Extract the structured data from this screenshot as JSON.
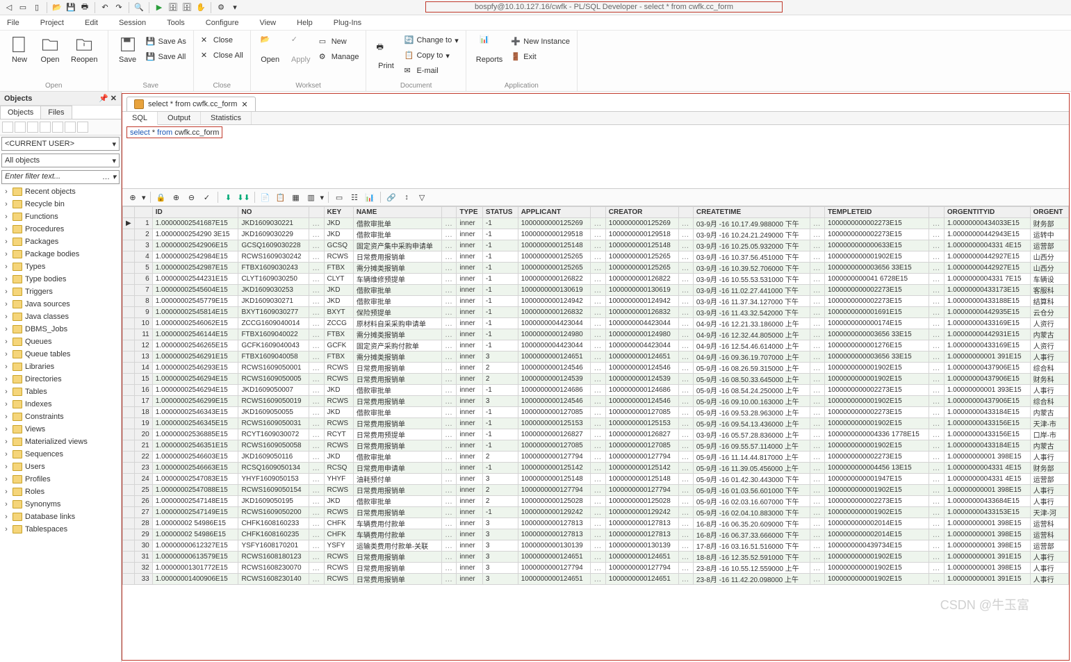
{
  "title": "bospfy@10.10.127.16/cwfk - PL/SQL Developer - select * from cwfk.cc_form",
  "menu": {
    "file": "File",
    "project": "Project",
    "edit": "Edit",
    "session": "Session",
    "tools": "Tools",
    "configure": "Configure",
    "view": "View",
    "help": "Help",
    "plugins": "Plug-Ins"
  },
  "ribbon": {
    "open": {
      "new": "New",
      "open": "Open",
      "reopen": "Reopen",
      "label": "Open"
    },
    "save": {
      "save": "Save",
      "saveas": "Save As",
      "saveall": "Save All",
      "label": "Save"
    },
    "close": {
      "close": "Close",
      "closeall": "Close All",
      "label": "Close"
    },
    "workset": {
      "open": "Open",
      "apply": "Apply",
      "new": "New",
      "manage": "Manage",
      "label": "Workset"
    },
    "doc": {
      "print": "Print",
      "changeto": "Change to",
      "copyto": "Copy to",
      "email": "E-mail",
      "label": "Document"
    },
    "app": {
      "reports": "Reports",
      "newinst": "New Instance",
      "exit": "Exit",
      "label": "Application"
    }
  },
  "sidebar": {
    "title": "Objects",
    "tabs": {
      "objects": "Objects",
      "files": "Files"
    },
    "user": "<CURRENT USER>",
    "scope": "All objects",
    "filter_ph": "Enter filter text...",
    "nodes": [
      "Recent objects",
      "Recycle bin",
      "Functions",
      "Procedures",
      "Packages",
      "Package bodies",
      "Types",
      "Type bodies",
      "Triggers",
      "Java sources",
      "Java classes",
      "DBMS_Jobs",
      "Queues",
      "Queue tables",
      "Libraries",
      "Directories",
      "Tables",
      "Indexes",
      "Constraints",
      "Views",
      "Materialized views",
      "Sequences",
      "Users",
      "Profiles",
      "Roles",
      "Synonyms",
      "Database links",
      "Tablespaces"
    ]
  },
  "doc": {
    "tab": "select * from cwfk.cc_form",
    "subtabs": {
      "sql": "SQL",
      "output": "Output",
      "stats": "Statistics"
    },
    "sql": {
      "kw1": "select",
      "rest": " * ",
      "kw2": "from",
      "tbl": " cwfk.cc_form"
    }
  },
  "cols": [
    "",
    "",
    "ID",
    "NO",
    "",
    "KEY",
    "NAME",
    "",
    "TYPE",
    "STATUS",
    "APPLICANT",
    "",
    "CREATOR",
    "",
    "CREATETIME",
    "",
    "TEMPLETEID",
    "",
    "ORGENTITYID",
    "ORGENT"
  ],
  "rows": [
    [
      "▶",
      "1",
      "1.00000002541687E15",
      "JKD1609030221",
      "…",
      "JKD",
      "借款审批单",
      "…",
      "inner",
      "-1",
      "1000000000125269",
      "…",
      "1000000000125269",
      "…",
      "03-9月 -16 10.17.49.988000 下午",
      "…",
      "1000000000002273E15",
      "…",
      "1.00000000434033E15",
      "财务部"
    ],
    [
      "",
      "2",
      "1.0000000254290 3E15",
      "JKD1609030229",
      "…",
      "JKD",
      "借款审批单",
      "…",
      "inner",
      "-1",
      "1000000000129518",
      "…",
      "1000000000129518",
      "…",
      "03-9月 -16 10.24.21.249000 下午",
      "…",
      "1000000000002273E15",
      "…",
      "1.00000000442943E15",
      "运转中"
    ],
    [
      "",
      "3",
      "1.00000002542906E15",
      "GCSQ1609030228",
      "…",
      "GCSQ",
      "固定资产集中采购申请单",
      "…",
      "inner",
      "-1",
      "1000000000125148",
      "…",
      "1000000000125148",
      "…",
      "03-9月 -16 10.25.05.932000 下午",
      "…",
      "1000000000000633E15",
      "…",
      "1.0000000004331 4E15",
      "运营部"
    ],
    [
      "",
      "4",
      "1.00000002542984E15",
      "RCWS1609030242",
      "…",
      "RCWS",
      "日常费用报销单",
      "…",
      "inner",
      "-1",
      "1000000000125265",
      "…",
      "1000000000125265",
      "…",
      "03-9月 -16 10.37.56.451000 下午",
      "…",
      "1000000000001902E15",
      "…",
      "1.00000000442927E15",
      "山西分"
    ],
    [
      "",
      "5",
      "1.00000002542987E15",
      "FTBX1609030243",
      "…",
      "FTBX",
      "需分摊类报销单",
      "…",
      "inner",
      "-1",
      "1000000000125265",
      "…",
      "1000000000125265",
      "…",
      "03-9月 -16 10.39.52.706000 下午",
      "…",
      "1000000000003656 33E15",
      "…",
      "1.00000000442927E15",
      "山西分"
    ],
    [
      "",
      "6",
      "1.00000002544231E15",
      "CLYT1609030250",
      "…",
      "CLYT",
      "车辆维修预提单",
      "…",
      "inner",
      "-1",
      "1000000000126822",
      "…",
      "1000000000126822",
      "…",
      "03-9月 -16 10.55.53.531000 下午",
      "…",
      "1000000000041 6728E15",
      "…",
      "1.0000000004331 7E15",
      "车辆设"
    ],
    [
      "",
      "7",
      "1.00000002545604E15",
      "JKD1609030253",
      "…",
      "JKD",
      "借款审批单",
      "…",
      "inner",
      "-1",
      "1000000000130619",
      "…",
      "1000000000130619",
      "…",
      "03-9月 -16 11.02.27.441000 下午",
      "…",
      "1000000000002273E15",
      "…",
      "1.00000000433173E15",
      "客服科"
    ],
    [
      "",
      "8",
      "1.00000002545779E15",
      "JKD1609030271",
      "…",
      "JKD",
      "借款审批单",
      "…",
      "inner",
      "-1",
      "1000000000124942",
      "…",
      "1000000000124942",
      "…",
      "03-9月 -16 11.37.34.127000 下午",
      "…",
      "1000000000002273E15",
      "…",
      "1.00000000433188E15",
      "结算科"
    ],
    [
      "",
      "9",
      "1.00000002545814E15",
      "BXYT1609030277",
      "…",
      "BXYT",
      "保险预提单",
      "…",
      "inner",
      "-1",
      "1000000000126832",
      "…",
      "1000000000126832",
      "…",
      "03-9月 -16 11.43.32.542000 下午",
      "…",
      "1000000000001691E15",
      "…",
      "1.00000000442935E15",
      "云仓分"
    ],
    [
      "",
      "10",
      "1.00000002546062E15",
      "ZCCG1609040014",
      "…",
      "ZCCG",
      "原材料自采采购申请单",
      "…",
      "inner",
      "-1",
      "1000000004423044",
      "…",
      "1000000004423044",
      "…",
      "04-9月 -16 12.21.33.186000 上午",
      "…",
      "1000000000000174E15",
      "…",
      "1.00000000433169E15",
      "人资行"
    ],
    [
      "",
      "11",
      "1.00000002546144E15",
      "FTBX1609040022",
      "…",
      "FTBX",
      "需分摊类报销单",
      "…",
      "inner",
      "-1",
      "1000000000124980",
      "…",
      "1000000000124980",
      "…",
      "04-9月 -16 12.32.44.805000 上午",
      "…",
      "1000000000003656 33E15",
      "…",
      "1.00000000442931E15",
      "内蒙古"
    ],
    [
      "",
      "12",
      "1.00000002546265E15",
      "GCFK1609040043",
      "…",
      "GCFK",
      "固定资产采购付款单",
      "…",
      "inner",
      "-1",
      "1000000004423044",
      "…",
      "1000000004423044",
      "…",
      "04-9月 -16 12.54.46.614000 上午",
      "…",
      "1000000000001276E15",
      "…",
      "1.00000000433169E15",
      "人资行"
    ],
    [
      "",
      "13",
      "1.00000002546291E15",
      "FTBX1609040058",
      "…",
      "FTBX",
      "需分摊类报销单",
      "…",
      "inner",
      "3",
      "1000000000124651",
      "…",
      "1000000000124651",
      "…",
      "04-9月 -16 09.36.19.707000 上午",
      "…",
      "1000000000003656 33E15",
      "…",
      "1.00000000001 391E15",
      "人事行"
    ],
    [
      "",
      "14",
      "1.00000002546293E15",
      "RCWS1609050001",
      "…",
      "RCWS",
      "日常费用报销单",
      "…",
      "inner",
      "2",
      "1000000000124546",
      "…",
      "1000000000124546",
      "…",
      "05-9月 -16 08.26.59.315000 上午",
      "…",
      "1000000000001902E15",
      "…",
      "1.00000000437906E15",
      "综合科"
    ],
    [
      "",
      "15",
      "1.00000002546294E15",
      "RCWS1609050005",
      "…",
      "RCWS",
      "日常费用报销单",
      "…",
      "inner",
      "2",
      "1000000000124539",
      "…",
      "1000000000124539",
      "…",
      "05-9月 -16 08.50.33.645000 上午",
      "…",
      "1000000000001902E15",
      "…",
      "1.00000000437906E15",
      "财务科"
    ],
    [
      "",
      "16",
      "1.00000002546294E15",
      "JKD1609050007",
      "…",
      "JKD",
      "借款审批单",
      "…",
      "inner",
      "-1",
      "1000000000124686",
      "…",
      "1000000000124686",
      "…",
      "05-9月 -16 08.54.24.250000 上午",
      "…",
      "1000000000002273E15",
      "…",
      "1.00000000001 393E15",
      "人事行"
    ],
    [
      "",
      "17",
      "1.00000002546299E15",
      "RCWS1609050019",
      "…",
      "RCWS",
      "日常费用报销单",
      "…",
      "inner",
      "3",
      "1000000000124546",
      "…",
      "1000000000124546",
      "…",
      "05-9月 -16 09.10.00.163000 上午",
      "…",
      "1000000000001902E15",
      "…",
      "1.00000000437906E15",
      "综合科"
    ],
    [
      "",
      "18",
      "1.00000002546343E15",
      "JKD1609050055",
      "…",
      "JKD",
      "借款审批单",
      "…",
      "inner",
      "-1",
      "1000000000127085",
      "…",
      "1000000000127085",
      "…",
      "05-9月 -16 09.53.28.963000 上午",
      "…",
      "1000000000002273E15",
      "…",
      "1.00000000433184E15",
      "内蒙古"
    ],
    [
      "",
      "19",
      "1.00000002546345E15",
      "RCWS1609050031",
      "…",
      "RCWS",
      "日常费用报销单",
      "…",
      "inner",
      "-1",
      "1000000000125153",
      "…",
      "1000000000125153",
      "…",
      "05-9月 -16 09.54.13.436000 上午",
      "…",
      "1000000000001902E15",
      "…",
      "1.00000000433156E15",
      "天津-市"
    ],
    [
      "",
      "20",
      "1.00000002536885E15",
      "RCYT1609030072",
      "…",
      "RCYT",
      "日常费用预提单",
      "…",
      "inner",
      "-1",
      "1000000000126827",
      "…",
      "1000000000126827",
      "…",
      "03-9月 -16 05.57.28.836000 上午",
      "…",
      "1000000000004336 1778E15",
      "…",
      "1.00000000433156E15",
      "口岸-市"
    ],
    [
      "",
      "21",
      "1.00000002546351E15",
      "RCWS1609050058",
      "…",
      "RCWS",
      "日常费用报销单",
      "…",
      "inner",
      "-1",
      "1000000000127085",
      "…",
      "1000000000127085",
      "…",
      "05-9月 -16 09.55.57.114000 上午",
      "…",
      "1000000000001902E15",
      "…",
      "1.00000000433184E15",
      "内蒙古"
    ],
    [
      "",
      "22",
      "1.00000002546603E15",
      "JKD1609050116",
      "…",
      "JKD",
      "借款审批单",
      "…",
      "inner",
      "2",
      "1000000000127794",
      "…",
      "1000000000127794",
      "…",
      "05-9月 -16 11.14.44.817000 上午",
      "…",
      "1000000000002273E15",
      "…",
      "1.00000000001 398E15",
      "人事行"
    ],
    [
      "",
      "23",
      "1.00000002546663E15",
      "RCSQ1609050134",
      "…",
      "RCSQ",
      "日常费用申请单",
      "…",
      "inner",
      "-1",
      "1000000000125142",
      "…",
      "1000000000125142",
      "…",
      "05-9月 -16 11.39.05.456000 上午",
      "…",
      "1000000000004456 13E15",
      "…",
      "1.0000000004331 4E15",
      "财务部"
    ],
    [
      "",
      "24",
      "1.00000002547083E15",
      "YHYF1609050153",
      "…",
      "YHYF",
      "油耗预付单",
      "…",
      "inner",
      "3",
      "1000000000125148",
      "…",
      "1000000000125148",
      "…",
      "05-9月 -16 01.42.30.443000 下午",
      "…",
      "1000000000001947E15",
      "…",
      "1.0000000004331 4E15",
      "运营部"
    ],
    [
      "",
      "25",
      "1.00000002547088E15",
      "RCWS1609050154",
      "…",
      "RCWS",
      "日常费用报销单",
      "…",
      "inner",
      "2",
      "1000000000127794",
      "…",
      "1000000000127794",
      "…",
      "05-9月 -16 01.03.56.601000 下午",
      "…",
      "1000000000001902E15",
      "…",
      "1.00000000001 398E15",
      "人事行"
    ],
    [
      "",
      "26",
      "1.00000002547148E15",
      "JKD1609050195",
      "…",
      "JKD",
      "借款审批单",
      "…",
      "inner",
      "2",
      "1000000000125028",
      "…",
      "1000000000125028",
      "…",
      "05-9月 -16 02.03.16.607000 下午",
      "…",
      "1000000000002273E15",
      "…",
      "1.00000000433684E15",
      "人事行"
    ],
    [
      "",
      "27",
      "1.00000002547149E15",
      "RCWS1609050200",
      "…",
      "RCWS",
      "日常费用报销单",
      "…",
      "inner",
      "-1",
      "1000000000129242",
      "…",
      "1000000000129242",
      "…",
      "05-9月 -16 02.04.10.883000 下午",
      "…",
      "1000000000001902E15",
      "…",
      "1.00000000433153E15",
      "天津-河"
    ],
    [
      "",
      "28",
      "1.00000002 54986E15",
      "CHFK1608160233",
      "…",
      "CHFK",
      "车辆费用付款单",
      "…",
      "inner",
      "3",
      "1000000000127813",
      "…",
      "1000000000127813",
      "…",
      "16-8月 -16 06.35.20.609000 下午",
      "…",
      "1000000000002014E15",
      "…",
      "1.00000000001 398E15",
      "运营科"
    ],
    [
      "",
      "29",
      "1.00000002 54986E15",
      "CHFK1608160235",
      "…",
      "CHFK",
      "车辆费用付款单",
      "…",
      "inner",
      "3",
      "1000000000127813",
      "…",
      "1000000000127813",
      "…",
      "16-8月 -16 06.37.33.666000 下午",
      "…",
      "1000000000002014E15",
      "…",
      "1.00000000001 398E15",
      "运营科"
    ],
    [
      "",
      "30",
      "1.00000000612327E15",
      "YSFY1608170201",
      "…",
      "YSFY",
      "运输类费用付款单-关联",
      "…",
      "inner",
      "3",
      "1000000000130139",
      "…",
      "1000000000130139",
      "…",
      "17-8月 -16 03.16.51.516000 下午",
      "…",
      "1000000000439734E15",
      "…",
      "1.00000000001 398E15",
      "运营部"
    ],
    [
      "",
      "31",
      "1.00000000613579E15",
      "RCWS1608180123",
      "…",
      "RCWS",
      "日常费用报销单",
      "…",
      "inner",
      "3",
      "1000000000124651",
      "…",
      "1000000000124651",
      "…",
      "18-8月 -16 12.35.52.591000 下午",
      "…",
      "1000000000001902E15",
      "…",
      "1.00000000001 391E15",
      "人事行"
    ],
    [
      "",
      "32",
      "1.00000001301772E15",
      "RCWS1608230070",
      "…",
      "RCWS",
      "日常费用报销单",
      "…",
      "inner",
      "3",
      "1000000000127794",
      "…",
      "1000000000127794",
      "…",
      "23-8月 -16 10.55.12.559000 上午",
      "…",
      "1000000000001902E15",
      "…",
      "1.00000000001 398E15",
      "人事行"
    ],
    [
      "",
      "33",
      "1.00000001400906E15",
      "RCWS1608230140",
      "…",
      "RCWS",
      "日常费用报销单",
      "…",
      "inner",
      "3",
      "1000000000124651",
      "…",
      "1000000000124651",
      "…",
      "23-8月 -16 11.42.20.098000 上午",
      "…",
      "1000000000001902E15",
      "…",
      "1.00000000001 391E15",
      "人事行"
    ]
  ]
}
